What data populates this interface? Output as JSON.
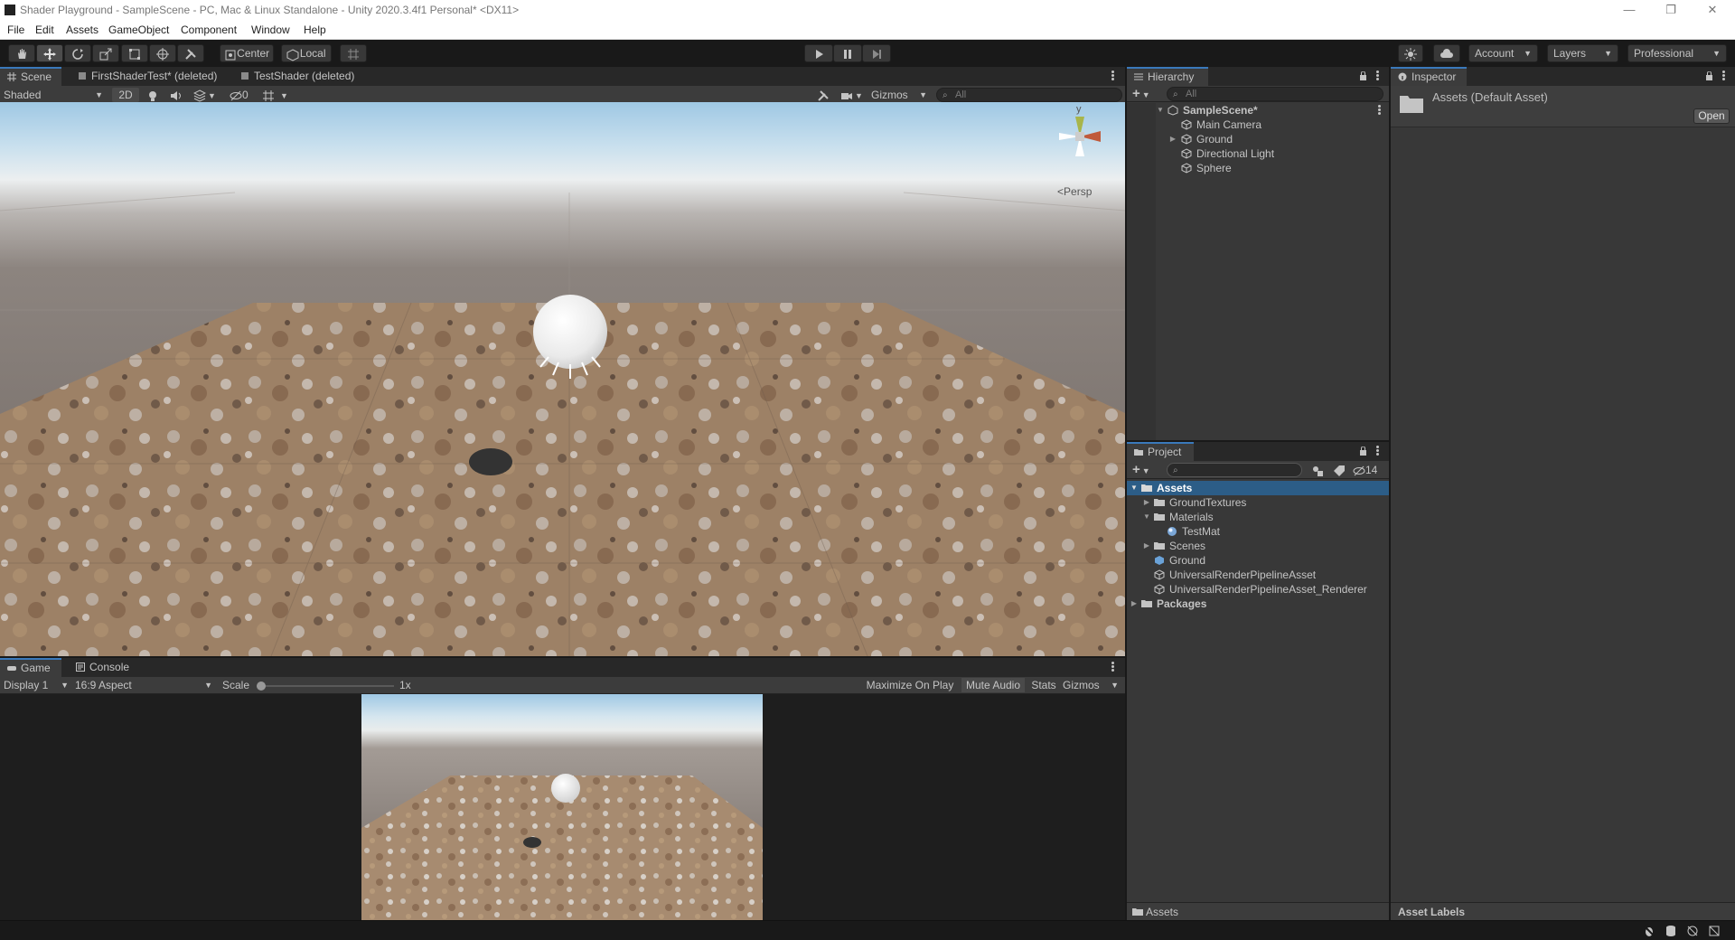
{
  "window": {
    "title": "Shader Playground - SampleScene - PC, Mac & Linux Standalone - Unity 2020.3.4f1 Personal* <DX11>",
    "minimize": "—",
    "restore": "❐",
    "close": "✕"
  },
  "menu": [
    "File",
    "Edit",
    "Assets",
    "GameObject",
    "Component",
    "Window",
    "Help"
  ],
  "toolbar": {
    "pivot_label": "Center",
    "space_label": "Local",
    "account_label": "Account",
    "layers_label": "Layers",
    "layout_label": "Professional"
  },
  "scene_panel": {
    "tabs": [
      "Scene",
      "FirstShaderTest* (deleted)",
      "TestShader (deleted)"
    ],
    "draw_mode": "Shaded",
    "mode_2d": "2D",
    "hidden_count": "0",
    "gizmos_label": "Gizmos",
    "search_placeholder": "All",
    "axis_y": "y",
    "projection_label": "Persp"
  },
  "hierarchy": {
    "tab": "Hierarchy",
    "search_placeholder": "All",
    "scene_name": "SampleScene*",
    "items": [
      "Main Camera",
      "Ground",
      "Directional Light",
      "Sphere"
    ]
  },
  "project": {
    "tab": "Project",
    "hidden_count": "14",
    "root": "Assets",
    "items": [
      "GroundTextures",
      "Materials",
      "TestMat",
      "Scenes",
      "Ground",
      "UniversalRenderPipelineAsset",
      "UniversalRenderPipelineAsset_Renderer"
    ],
    "packages": "Packages",
    "breadcrumb": "Assets"
  },
  "inspector": {
    "tab": "Inspector",
    "asset_title": "Assets (Default Asset)",
    "open_button": "Open",
    "footer": "Asset Labels"
  },
  "game_panel": {
    "tabs": [
      "Game",
      "Console"
    ],
    "display": "Display 1",
    "aspect": "16:9 Aspect",
    "scale_label": "Scale",
    "scale_value": "1x",
    "maximize_on_play": "Maximize On Play",
    "mute_audio": "Mute Audio",
    "stats": "Stats",
    "gizmos_label": "Gizmos"
  },
  "colors": {
    "accent": "#3a79bb",
    "selection": "#2c5d87",
    "panel": "#383838",
    "toolbar": "#191919"
  }
}
